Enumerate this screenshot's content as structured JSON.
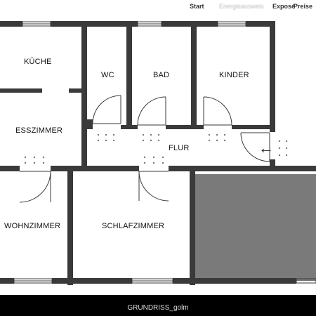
{
  "topbar": {
    "items": [
      "Start",
      "Exposé",
      "Preise"
    ],
    "blurred_link": "Energieausweis"
  },
  "floorplan": {
    "rooms": {
      "kueche": "KÜCHE",
      "wc": "WC",
      "bad": "BAD",
      "kinder": "KINDER",
      "esszimmer": "ESSZIMMER",
      "flur": "FLUR",
      "wohnzimmer": "WOHNZIMMER",
      "schlafzimmer": "SCHLAFZIMMER"
    },
    "wall_color": "#3a3a3a",
    "shaded_area_color": "#7a7a7a",
    "entrance_icon": "entrance-arrow-icon"
  },
  "caption": "GRUNDRISS_golm"
}
